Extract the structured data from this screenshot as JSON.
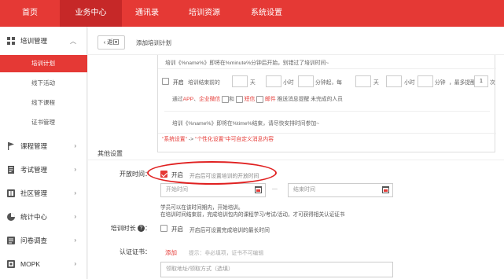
{
  "topnav": {
    "items": [
      "首页",
      "业务中心",
      "通讯录",
      "培训资源",
      "系统设置"
    ],
    "active_index": 1
  },
  "sidebar": {
    "groups": [
      {
        "label": "培训管理",
        "icon": "grid-icon",
        "expanded": true,
        "subitems": [
          "培训计划",
          "线下活动",
          "线下课程",
          "证书管理"
        ],
        "active_sub": 0
      },
      {
        "label": "课程管理",
        "icon": "flag-icon"
      },
      {
        "label": "考试管理",
        "icon": "document-icon"
      },
      {
        "label": "社区管理",
        "icon": "community-icon"
      },
      {
        "label": "统计中心",
        "icon": "chart-icon"
      },
      {
        "label": "问卷调查",
        "icon": "survey-icon"
      },
      {
        "label": "MOPK",
        "icon": "pk-icon"
      }
    ]
  },
  "header": {
    "back_label": "返回",
    "breadcrumb": "添加培训计划"
  },
  "notify_panel": {
    "template_top": "培训《%name%》即将在%minute%分钟后开始，别错过了培训时间~",
    "start_label": "开启",
    "before_label": "培训结束前的",
    "day_unit": "天",
    "hour_unit": "小时",
    "minute_start_label": "分钟起，每",
    "minute_unit": "分钟",
    "max_label": "，最多提醒",
    "max_value": "1",
    "times_unit": "次",
    "channel_prefix": "通过",
    "channel_app": "APP",
    "channel_wechat": "企业微信",
    "channel_and": "和",
    "channel_sms": "短信",
    "channel_mail": "邮件",
    "channel_suffix": "推送消息提醒 未完成的人员",
    "template_bottom": "培训《%name%》即将在%time%结束，请尽快安排时间参加~",
    "note_part1": "\"系统设置\"",
    "note_arrow": "->",
    "note_part2": "\"个性化设置\"",
    "note_part3": "中可自定义消息内容"
  },
  "other_settings": {
    "title": "其他设置",
    "open_time": {
      "label": "开放时间：",
      "enable_label": "开启",
      "hint": "开启后可设置培训的开放时间",
      "start_placeholder": "开始时间",
      "end_placeholder": "结束时间",
      "dash": "—",
      "desc_line1": "学员可以在该时间期内，开始培训。",
      "desc_line2": "在培训时间结束前，完成培训包内的课程学习/考试/活动，才可获得相关认证证书"
    },
    "duration": {
      "label": "培训时长",
      "help": "?",
      "colon": "：",
      "enable_label": "开启",
      "hint": "开启后可设置完成培训的最长时间"
    },
    "certificate": {
      "label": "认证证书：",
      "add_label": "添加",
      "hint": "提示：非必填项，证书不可编辑",
      "address_placeholder": "领取地址/领取方式（选填）"
    }
  },
  "colors": {
    "brand": "#e53935",
    "active_nav": "#c62828",
    "annotation": "#e02020"
  }
}
